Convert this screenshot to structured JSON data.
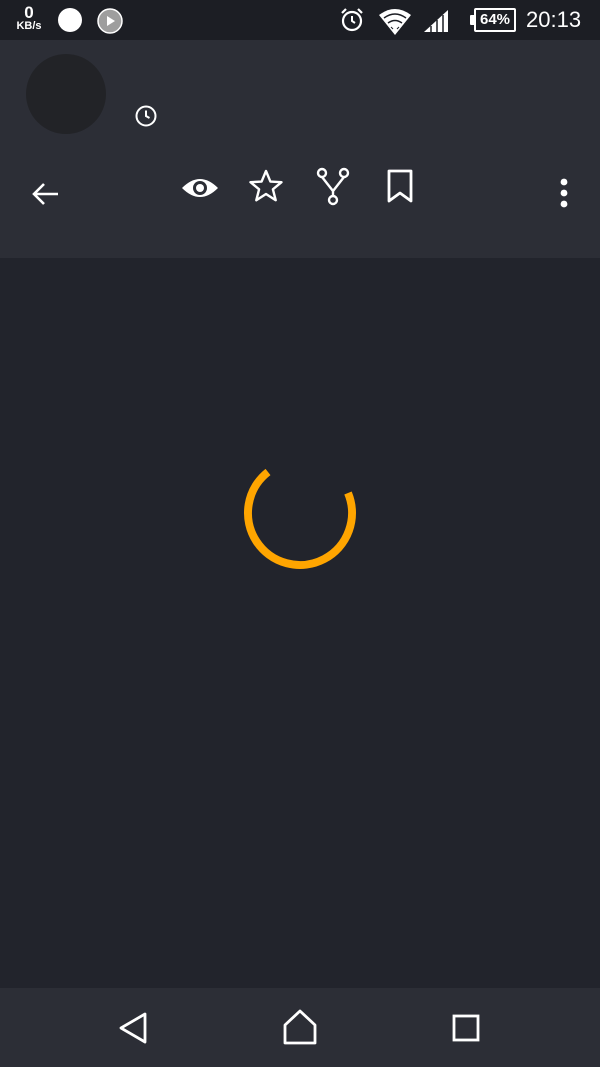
{
  "status_bar": {
    "net_speed_value": "0",
    "net_speed_unit": "KB/s",
    "battery_percent": "64%",
    "time": "20:13"
  },
  "header": {
    "icons": [
      "back-arrow-icon",
      "eye-icon",
      "star-icon",
      "fork-icon",
      "bookmark-icon",
      "more-vert-icon",
      "clock-icon"
    ]
  },
  "loading": {
    "spinner_color": "#ffa500"
  },
  "nav_bar": {
    "icons": [
      "nav-back-icon",
      "nav-home-icon",
      "nav-recent-icon"
    ]
  },
  "colors": {
    "status_bar_bg": "#1c1e24",
    "header_bg": "#2c2e36",
    "content_bg": "#22242c"
  }
}
